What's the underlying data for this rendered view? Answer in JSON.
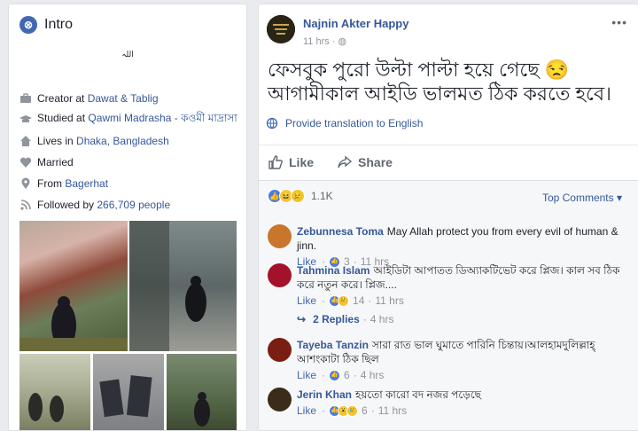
{
  "intro": {
    "title": "Intro",
    "bio": "اللہ",
    "rows": [
      {
        "icon": "briefcase-icon",
        "prefix": "Creator at ",
        "link": "Dawat & Tablig"
      },
      {
        "icon": "graduation-cap-icon",
        "prefix": "Studied at ",
        "link": "Qawmi Madrasha - কওমী মাদ্রাসা"
      },
      {
        "icon": "home-icon",
        "prefix": "Lives in ",
        "link": "Dhaka, Bangladesh"
      },
      {
        "icon": "heart-icon",
        "prefix": "Married",
        "link": ""
      },
      {
        "icon": "map-pin-icon",
        "prefix": "From ",
        "link": "Bagerhat"
      },
      {
        "icon": "rss-icon",
        "prefix": "Followed by ",
        "link": "266,709 people"
      }
    ]
  },
  "post": {
    "author": "Najnin Akter Happy",
    "time": "11 hrs",
    "text": "ফেসবুক পুরো উল্টা পাল্টা হয়ে গেছে 😒 আগামীকাল আইডি ভালমত ঠিক করতে হবে।",
    "translate": "Provide translation to English",
    "like_label": "Like",
    "share_label": "Share",
    "reaction_count": "1.1K",
    "top_comments": "Top Comments ▾"
  },
  "comments": [
    {
      "name": "Zebunnesa Toma",
      "text": "May Allah protect you from every evil of human & jinn.",
      "like": "Like",
      "reacts": "3",
      "time": "11 hrs",
      "avatar_color": "#c7762b"
    },
    {
      "name": "Tahmina Islam",
      "text": "আইডিটা আপাতত ডিঅ্যাকটিভেট করে প্লিজ। কাল সব ঠিক করে নতুন করে। প্লিজ....",
      "like": "Like",
      "reacts": "14",
      "time": "11 hrs",
      "avatar_color": "#a3122a",
      "replies": "2 Replies",
      "replies_time": "4 hrs"
    },
    {
      "name": "Tayeba Tanzin",
      "text": "সারা রাত ভাল ঘুমাতে পারিনি চিন্তায়।আলহামদুলিল্লাহ্ আশংকাটা ঠিক ছিল",
      "like": "Like",
      "reacts": "6",
      "time": "4 hrs",
      "avatar_color": "#7a1e14"
    },
    {
      "name": "Jerin Khan",
      "text": "হয়তো কারো বদ নজর পড়েছে",
      "like": "Like",
      "reacts": "6",
      "time": "11 hrs",
      "avatar_color": "#3a2c18"
    }
  ]
}
